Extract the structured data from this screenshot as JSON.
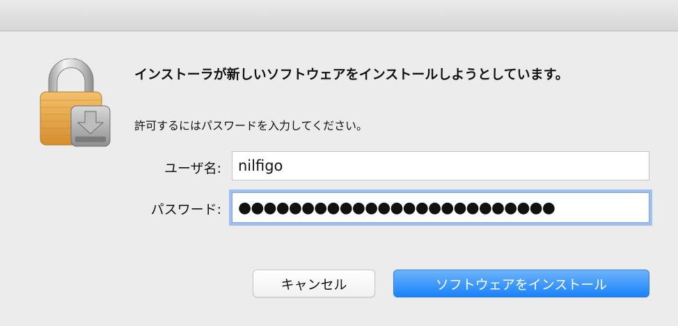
{
  "dialog": {
    "heading": "インストーラが新しいソフトウェアをインストールしようとしています。",
    "subtext": "許可するにはパスワードを入力してください。",
    "lock_icon": "lock-with-installer-icon"
  },
  "form": {
    "username_label": "ユーザ名:",
    "username_value": "nilfigo",
    "password_label": "パスワード:",
    "password_value": "●●●●●●●●●●●●●●●●●●●●●●●●●"
  },
  "buttons": {
    "cancel_label": "キャンセル",
    "install_label": "ソフトウェアをインストール"
  },
  "colors": {
    "accent": "#1a82fb",
    "focus_ring": "#9ebff0",
    "lock_body": "#e8a94a"
  }
}
